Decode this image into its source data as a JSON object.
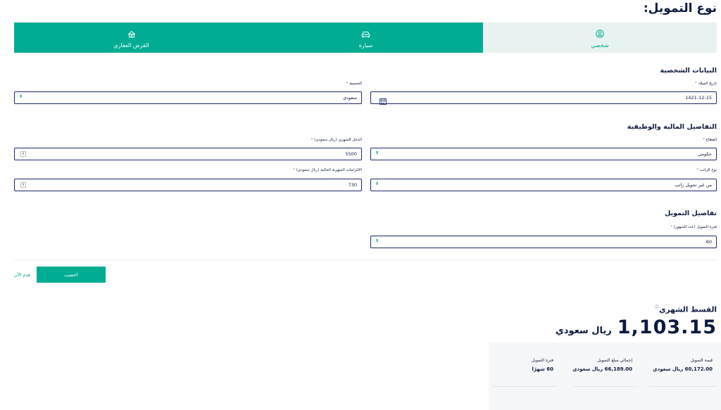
{
  "page_title": "نوع التمويل:",
  "tabs": [
    {
      "label": "القرض العقاري",
      "icon": "house-money-icon",
      "active": false
    },
    {
      "label": "سيارة",
      "icon": "car-icon",
      "active": false
    },
    {
      "label": "شخصي",
      "icon": "person-icon",
      "active": true
    }
  ],
  "personal": {
    "title": "البيانات الشخصية",
    "birth_label": "تاريخ الميلاد",
    "birth_value": "1421-12-15",
    "nationality_label": "الجنسية",
    "nationality_value": "سعودي"
  },
  "financial": {
    "title": "التفاصيل المالية والوظيفية",
    "sector_label": "القطاع",
    "sector_value": "حكومي",
    "income_label": "الدخل الشهري (ريال سعودي)",
    "income_value": "5500",
    "salary_type_label": "نوع الراتب",
    "salary_type_value": "من غير تحويل راتب",
    "obligations_label": "الالتزامات الشهرية الحالية (ريال سعودي)",
    "obligations_value": "730"
  },
  "financing": {
    "title": "تفاصيل التمويل",
    "period_label": "فترة التمويل (عدد الشهور)",
    "period_value": "60"
  },
  "required_mark": "*",
  "actions": {
    "calculate": "احسب",
    "apply": "قدم الآن"
  },
  "result": {
    "title": "القسط الشهري",
    "info_mark": "ⓘ",
    "amount": "1,103.15",
    "currency": "ريال سعودي",
    "items": [
      {
        "label": "قيمة التمويل",
        "value": "60,172.00 ريال سعودي"
      },
      {
        "label": "إجمالي مبلغ التمويل",
        "value": "66,189.00 ريال سعودي"
      },
      {
        "label": "فترة التمويل",
        "value": "60 شهرًا"
      }
    ]
  },
  "colors": {
    "accent": "#00ad93",
    "active_tab_bg": "#e8f3f1",
    "text": "#0d1b3e",
    "border": "#1a2a6c"
  }
}
